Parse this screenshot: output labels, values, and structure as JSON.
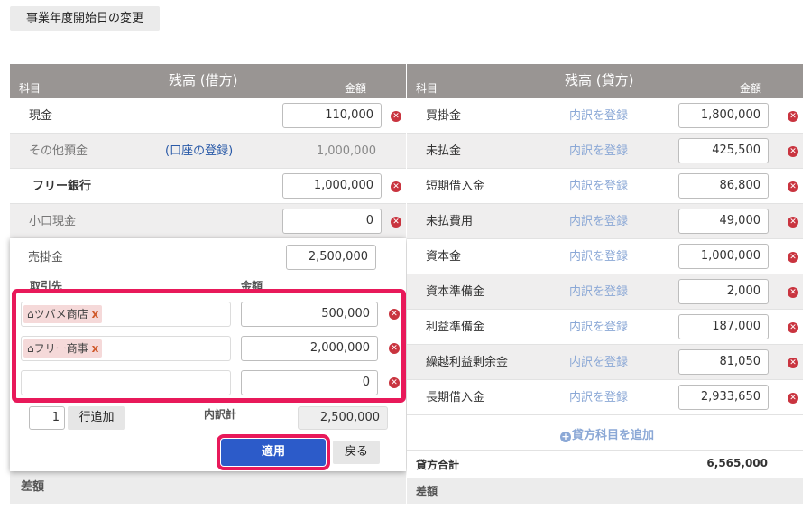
{
  "top_button": "事業年度開始日の変更",
  "left": {
    "title": "残高 (借方)",
    "col_subject": "科目",
    "col_amount": "金額",
    "rows": [
      {
        "name": "現金",
        "value": "110,000"
      },
      {
        "name": "その他預金",
        "link": "(口座の登録)",
        "value": "1,000,000"
      },
      {
        "name": "フリー銀行",
        "value": "1,000,000"
      },
      {
        "name": "小口現金",
        "value": "0"
      }
    ],
    "popup": {
      "account": "売掛金",
      "account_value": "2,500,000",
      "col_partner": "取引先",
      "col_amount": "金額",
      "partners": [
        {
          "name": "ツバメ商店",
          "value": "500,000"
        },
        {
          "name": "フリー商事",
          "value": "2,000,000"
        },
        {
          "name": "",
          "value": "0"
        }
      ],
      "row_count": "1",
      "add_row": "行追加",
      "subtotal_label": "内訳計",
      "subtotal_value": "2,500,000",
      "apply": "適用",
      "back": "戻る"
    },
    "diff_label": "差額"
  },
  "right": {
    "title": "残高 (貸方)",
    "col_subject": "科目",
    "col_amount": "金額",
    "breakdown_link": "内訳を登録",
    "rows": [
      {
        "name": "買掛金",
        "value": "1,800,000"
      },
      {
        "name": "未払金",
        "value": "425,500"
      },
      {
        "name": "短期借入金",
        "value": "86,800"
      },
      {
        "name": "未払費用",
        "value": "49,000"
      },
      {
        "name": "資本金",
        "value": "1,000,000"
      },
      {
        "name": "資本準備金",
        "value": "2,000"
      },
      {
        "name": "利益準備金",
        "value": "187,000"
      },
      {
        "name": "繰越利益剰余金",
        "value": "81,050"
      },
      {
        "name": "長期借入金",
        "value": "2,933,650"
      }
    ],
    "add_account": "貸方科目を追加",
    "total_label": "貸方合計",
    "total_value": "6,565,000",
    "diff_label": "差額"
  },
  "colors": {
    "header": "#999593",
    "danger": "#c9343f",
    "highlight": "#e8195a",
    "primary": "#2c5bc9"
  }
}
